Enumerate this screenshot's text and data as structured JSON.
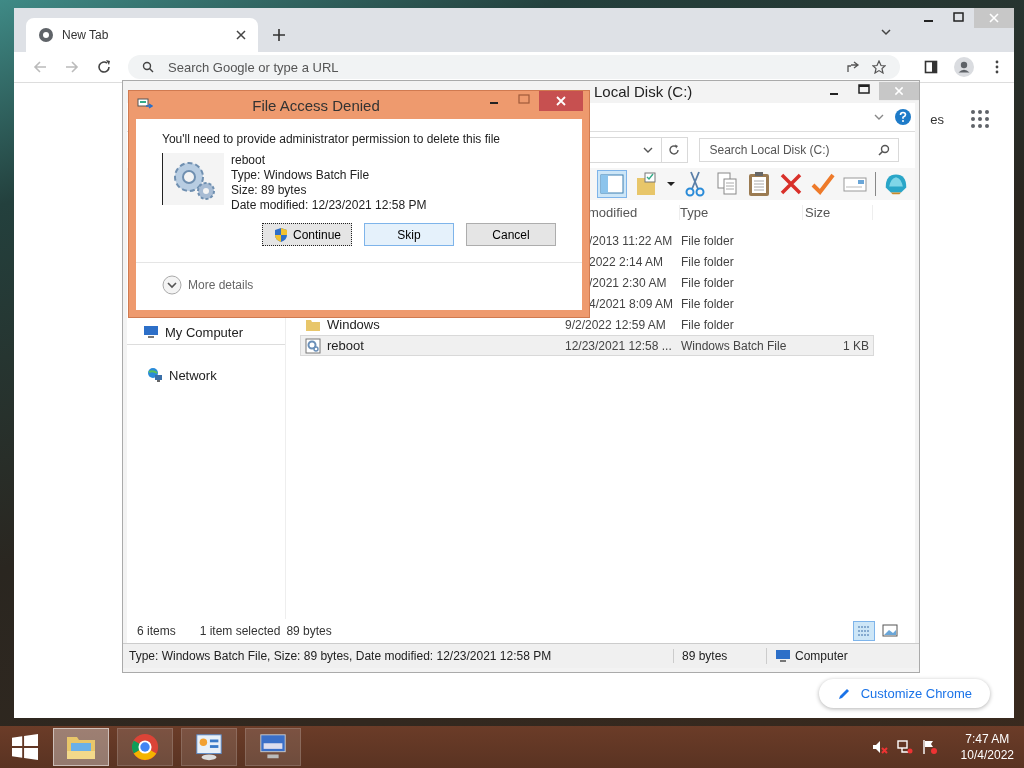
{
  "browser": {
    "tab": {
      "title": "New Tab"
    },
    "omnibox": {
      "placeholder": "Search Google or type a URL"
    },
    "shortcut_text": "es",
    "customize_button": "Customize Chrome"
  },
  "explorer": {
    "title": "Local Disk (C:)",
    "search": {
      "placeholder": "Search Local Disk (C:)"
    },
    "columns": [
      "modified",
      "Type",
      "Size"
    ],
    "nav": [
      {
        "label": "My Computer",
        "kind": "computer"
      },
      {
        "label": "Network",
        "kind": "network"
      }
    ],
    "rows": [
      {
        "date": "/2013 11:22 AM",
        "type": "File folder",
        "selected": false
      },
      {
        "date": "2022 2:14 AM",
        "type": "File folder",
        "selected": false
      },
      {
        "date": "/2021 2:30 AM",
        "type": "File folder",
        "selected": false
      },
      {
        "date": "4/2021 8:09 AM",
        "type": "File folder",
        "selected": false
      },
      {
        "name": "Windows",
        "date": "9/2/2022 12:59 AM",
        "type": "File folder",
        "kind": "folder",
        "selected": false
      },
      {
        "name": "reboot",
        "date": "12/23/2021 12:58 ...",
        "type": "Windows Batch File",
        "size": "1 KB",
        "kind": "batch",
        "selected": true
      }
    ],
    "status": {
      "count": "6 items",
      "selection": "1 item selected",
      "size": "89 bytes"
    },
    "details_bar": {
      "text": "Type: Windows Batch File, Size: 89 bytes, Date modified: 12/23/2021 12:58 PM",
      "size": "89 bytes",
      "zone": "Computer"
    }
  },
  "dialog": {
    "title": "File Access Denied",
    "message": "You'll need to provide administrator permission to delete this file",
    "file": {
      "name": "reboot",
      "type": "Type: Windows Batch File",
      "size": "Size: 89 bytes",
      "date": "Date modified: 12/23/2021 12:58 PM"
    },
    "buttons": [
      {
        "label": "Continue",
        "kind": "shield",
        "focused": true,
        "highlighted": false
      },
      {
        "label": "Skip",
        "kind": "plain",
        "focused": false,
        "highlighted": true
      },
      {
        "label": "Cancel",
        "kind": "plain",
        "focused": false,
        "highlighted": false
      }
    ],
    "more_details": "More details"
  },
  "taskbar": {
    "apps": [
      {
        "kind": "folder",
        "selected": true
      },
      {
        "kind": "browser",
        "selected": false
      },
      {
        "kind": "panel",
        "selected": false
      },
      {
        "kind": "monitor",
        "selected": false
      }
    ],
    "clock": {
      "time": "7:47 AM",
      "date": "10/4/2022"
    }
  }
}
